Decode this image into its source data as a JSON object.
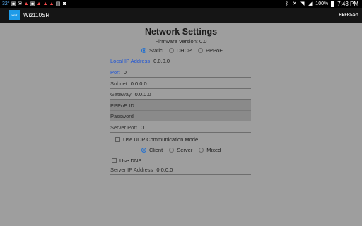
{
  "status_bar": {
    "temperature": "32°",
    "left_icons": [
      "gallery-icon",
      "email-icon",
      "alert-icon",
      "alert-icon",
      "photo-icon",
      "alert-icon",
      "alert-icon",
      "alert-icon",
      "image-icon",
      "camera-icon"
    ],
    "battery": "100%",
    "time": "7:43 PM"
  },
  "app_bar": {
    "logo": "WIZ",
    "title": "Wiz110SR",
    "refresh": "REFRESH"
  },
  "page": {
    "title": "Network Settings",
    "firmware": "Firmware Version: 0.0"
  },
  "ip_mode": {
    "options": [
      "Static",
      "DHCP",
      "PPPoE"
    ],
    "selected": "Static"
  },
  "fields": {
    "local_ip": {
      "label": "Local IP Address",
      "value": "0.0.0.0"
    },
    "port": {
      "label": "Port",
      "value": "0"
    },
    "subnet": {
      "label": "Subnet",
      "value": "0.0.0.0"
    },
    "gateway": {
      "label": "Gateway",
      "value": "0.0.0.0"
    },
    "pppoe_id": {
      "label": "PPPoE ID",
      "value": ""
    },
    "password": {
      "label": "Password",
      "value": ""
    },
    "server_port": {
      "label": "Server Port",
      "value": "0"
    },
    "server_ip": {
      "label": "Server IP Address",
      "value": "0.0.0.0"
    }
  },
  "udp": {
    "label": "Use UDP Communication Mode",
    "checked": false
  },
  "mode": {
    "options": [
      "Client",
      "Server",
      "Mixed"
    ],
    "selected": "Client"
  },
  "dns": {
    "label": "Use DNS",
    "checked": false
  },
  "colors": {
    "accent": "#1f6fd1",
    "background": "#9e9e9e",
    "app_bar": "#151515",
    "logo": "#1e9be8"
  }
}
